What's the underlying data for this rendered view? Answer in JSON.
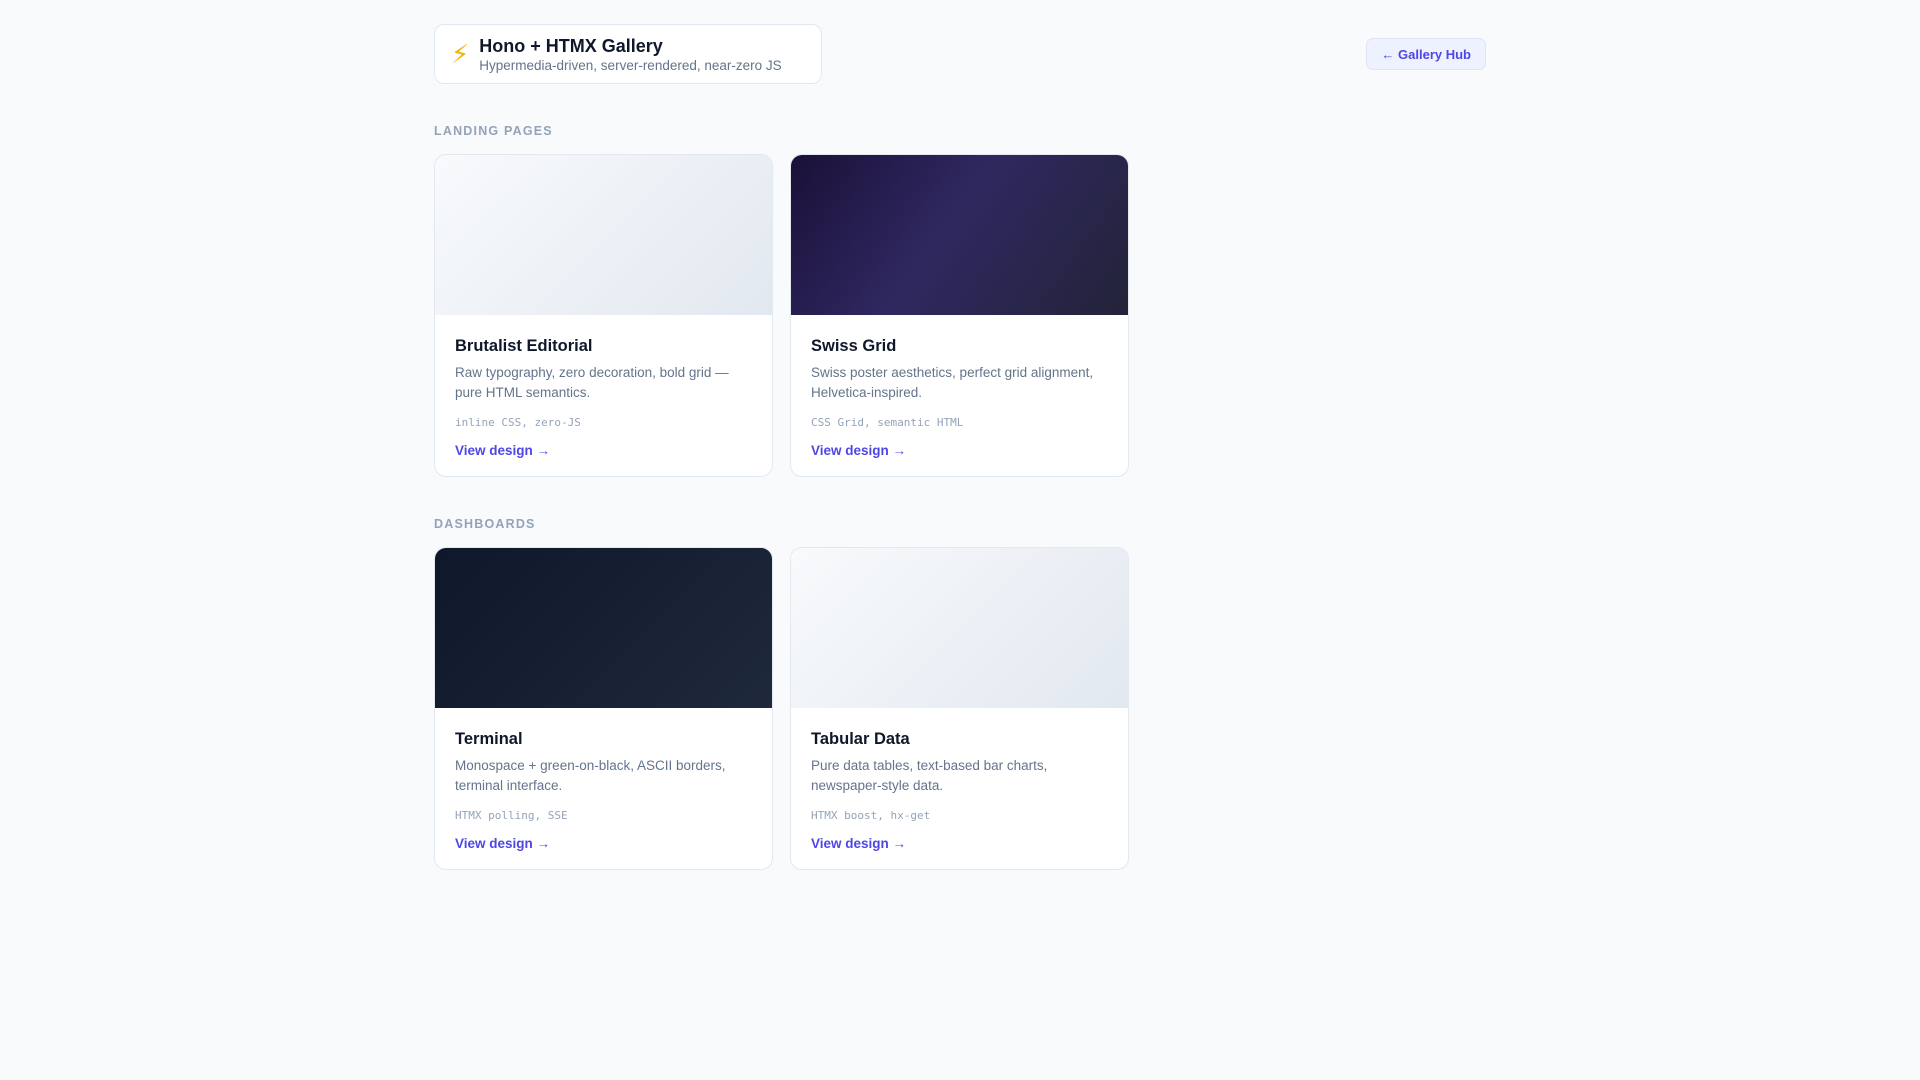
{
  "header": {
    "icon": "lightning-icon",
    "title": "Hono + HTMX Gallery",
    "subtitle": "Hypermedia-driven, server-rendered, near-zero JS",
    "hub_link": "← Gallery Hub"
  },
  "colors": {
    "accent": "#4f46e5",
    "background": "#f8fafc",
    "muted": "#64748b"
  },
  "sections": [
    {
      "title": "LANDING PAGES",
      "cards": [
        {
          "title": "Brutalist Editorial",
          "desc": "Raw typography, zero decoration, bold grid — pure HTML semantics.",
          "tags": "inline CSS, zero-JS",
          "link": "View design →"
        },
        {
          "title": "Swiss Grid",
          "desc": "Swiss poster aesthetics, perfect grid alignment, Helvetica-inspired.",
          "tags": "CSS Grid, semantic HTML",
          "link": "View design →"
        }
      ]
    },
    {
      "title": "DASHBOARDS",
      "cards": [
        {
          "title": "Terminal",
          "desc": "Monospace + green-on-black, ASCII borders, terminal interface.",
          "tags": "HTMX polling, SSE",
          "link": "View design →"
        },
        {
          "title": "Tabular Data",
          "desc": "Pure data tables, text-based bar charts, newspaper-style data.",
          "tags": "HTMX boost, hx-get",
          "link": "View design →"
        }
      ]
    }
  ]
}
